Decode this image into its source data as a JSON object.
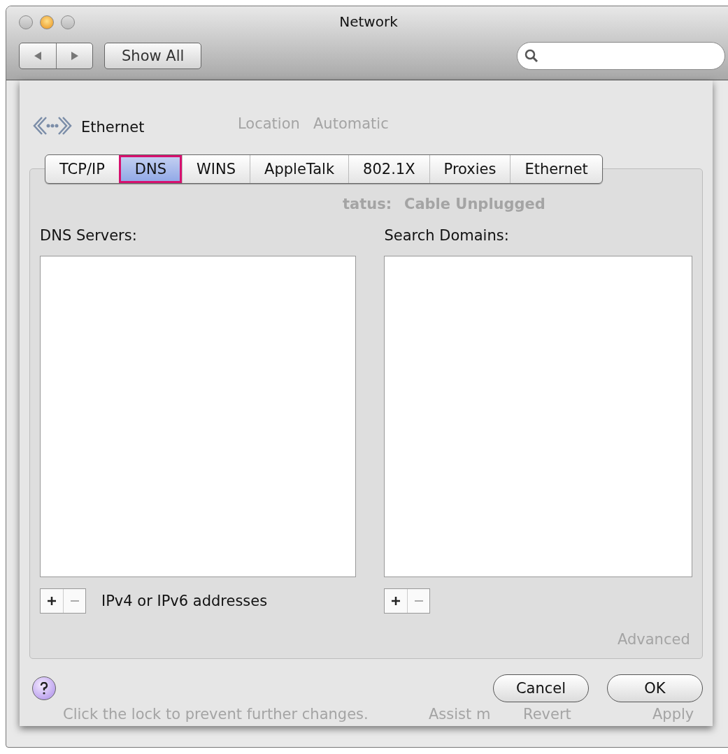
{
  "window": {
    "title": "Network"
  },
  "toolbar": {
    "show_all": "Show All"
  },
  "service": {
    "name": "Ethernet"
  },
  "tabs": [
    {
      "label": "TCP/IP",
      "selected": false
    },
    {
      "label": "DNS",
      "selected": true
    },
    {
      "label": "WINS",
      "selected": false
    },
    {
      "label": "AppleTalk",
      "selected": false
    },
    {
      "label": "802.1X",
      "selected": false
    },
    {
      "label": "Proxies",
      "selected": false
    },
    {
      "label": "Ethernet",
      "selected": false
    }
  ],
  "dns_servers": {
    "label": "DNS Servers:",
    "hint": "IPv4 or IPv6 addresses"
  },
  "search_domains": {
    "label": "Search Domains:"
  },
  "buttons": [
    "Cancel",
    "OK"
  ],
  "background_window": {
    "location_label": "Location",
    "location_value": "Automatic",
    "status_label": "tatus:",
    "status_value": "Cable Unplugged",
    "advanced": "Advanced",
    "lock_note": "Click the lock to prevent further changes.",
    "assist": "Assist m",
    "revert": "Revert",
    "apply": "Apply"
  }
}
